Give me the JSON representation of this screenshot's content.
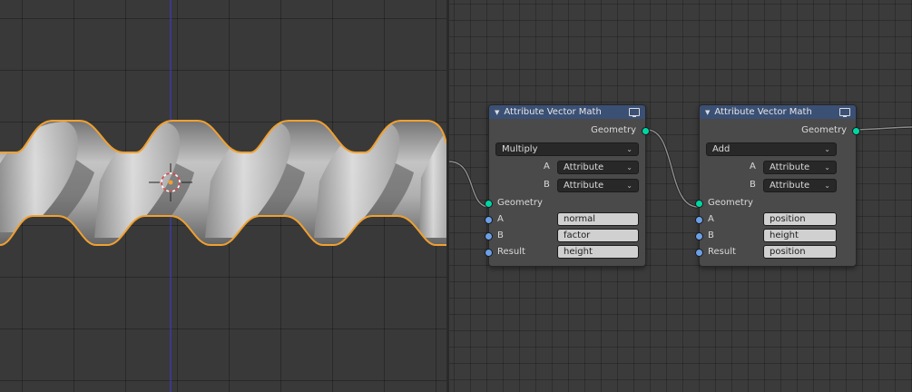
{
  "nodes": [
    {
      "title": "Attribute Vector Math",
      "output_label": "Geometry",
      "operation": "Multiply",
      "type_rows": [
        {
          "label": "A",
          "value": "Attribute"
        },
        {
          "label": "B",
          "value": "Attribute"
        }
      ],
      "geometry_input": "Geometry",
      "attr_inputs": [
        {
          "label": "A",
          "value": "normal"
        },
        {
          "label": "B",
          "value": "factor"
        },
        {
          "label": "Result",
          "value": "height"
        }
      ]
    },
    {
      "title": "Attribute Vector Math",
      "output_label": "Geometry",
      "operation": "Add",
      "type_rows": [
        {
          "label": "A",
          "value": "Attribute"
        },
        {
          "label": "B",
          "value": "Attribute"
        }
      ],
      "geometry_input": "Geometry",
      "attr_inputs": [
        {
          "label": "A",
          "value": "position"
        },
        {
          "label": "B",
          "value": "height"
        },
        {
          "label": "Result",
          "value": "position"
        }
      ]
    }
  ],
  "colors": {
    "node_header": "#3b5075",
    "geometry_socket": "#00d6a3",
    "attribute_socket": "#6ba0e8",
    "selection_outline": "#f0a030",
    "wire": "#8c8c8c"
  }
}
